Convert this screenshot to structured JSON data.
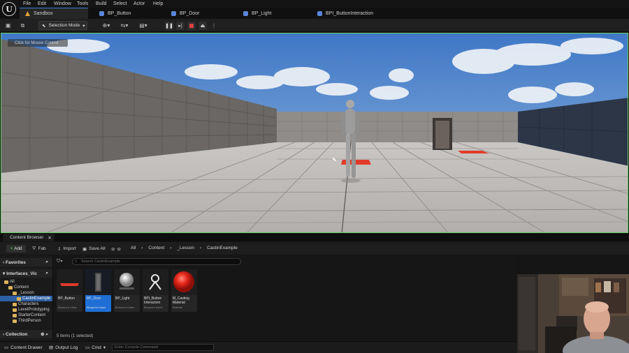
{
  "menu": [
    "File",
    "Edit",
    "Window",
    "Tools",
    "Build",
    "Select",
    "Actor",
    "Help"
  ],
  "tabs": [
    {
      "label": "Sandbox",
      "kind": "level"
    },
    {
      "label": "BP_Button",
      "kind": "blueprint"
    },
    {
      "label": "BP_Door",
      "kind": "blueprint"
    },
    {
      "label": "BP_Light",
      "kind": "blueprint"
    },
    {
      "label": "BPI_ButtonInteraction",
      "kind": "interface"
    }
  ],
  "toolbar": {
    "selection_mode": "Selection Mode"
  },
  "viewport": {
    "hint": "Click for Mouse Control"
  },
  "content_browser": {
    "tab_label": "Content Browser",
    "add_label": "Add",
    "fab_label": "Fab",
    "import_label": "Import",
    "save_all_label": "Save All",
    "breadcrumb": [
      "All",
      "Content",
      "_Lesson",
      "CastinExample"
    ],
    "search_placeholder": "Search CastinExample",
    "sidebar": {
      "favorites_label": "Favorites",
      "project_label": "Interfaces_Vic",
      "tree": [
        {
          "label": "All",
          "depth": 0
        },
        {
          "label": "Content",
          "depth": 1
        },
        {
          "label": "_Lesson",
          "depth": 2
        },
        {
          "label": "CastinExample",
          "depth": 3,
          "selected": true
        },
        {
          "label": "Characters",
          "depth": 2
        },
        {
          "label": "LevelPrototyping",
          "depth": 2
        },
        {
          "label": "StarterContent",
          "depth": 2
        },
        {
          "label": "ThirdPerson",
          "depth": 2
        }
      ],
      "collections_label": "Collection"
    },
    "assets": [
      {
        "name": "BP_Button",
        "type": "Blueprint Class",
        "thumb": "red-plate"
      },
      {
        "name": "BP_Door",
        "type": "Blueprint Class",
        "thumb": "door",
        "selected": true
      },
      {
        "name": "BP_Light",
        "type": "Blueprint Class",
        "thumb": "sphere"
      },
      {
        "name": "BPI_Button Interaction",
        "type": "Blueprint Interf.",
        "thumb": "interface"
      },
      {
        "name": "M_Casting Material",
        "type": "Material",
        "thumb": "red-sphere"
      }
    ],
    "status": "5 items (1 selected)"
  },
  "bottom": {
    "drawer_label": "Content Drawer",
    "output_label": "Output Log",
    "cmd_label": "Cmd",
    "console_placeholder": "Enter Console Command"
  },
  "colors": {
    "accent": "#3a7bd5",
    "viewport_border": "#6ad36a",
    "selected": "#1f6fd6",
    "stop": "#e04040"
  }
}
